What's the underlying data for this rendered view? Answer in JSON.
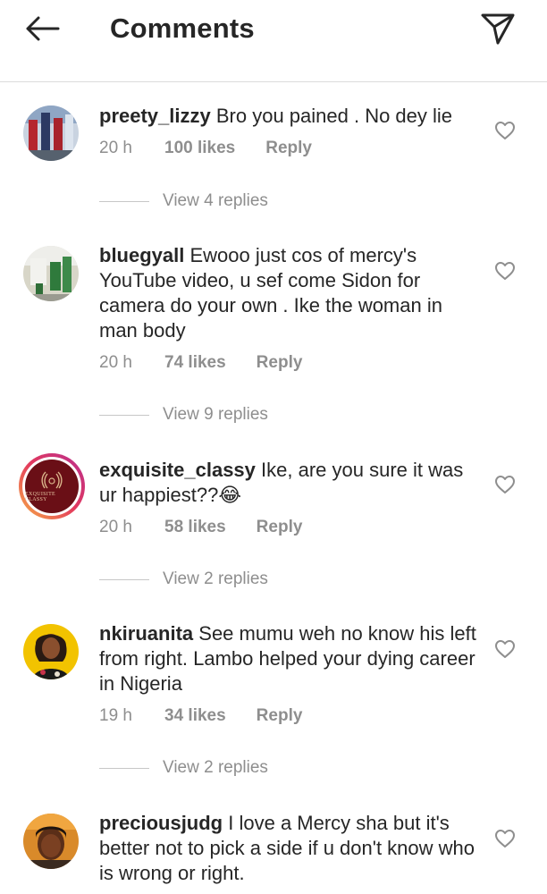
{
  "header": {
    "title": "Comments",
    "back_icon": "arrow-left-icon",
    "share_icon": "send-icon"
  },
  "comments": [
    {
      "username": "preety_lizzy",
      "text": "Bro you pained . No dey lie",
      "time": "20 h",
      "likes": "100 likes",
      "reply": "Reply",
      "view_replies": "View 4 replies"
    },
    {
      "username": "bluegyall",
      "text": "Ewooo just cos of mercy's YouTube video, u sef come Sidon for camera do your own . Ike the woman in man body",
      "time": "20 h",
      "likes": "74 likes",
      "reply": "Reply",
      "view_replies": "View 9 replies"
    },
    {
      "username": "exquisite_classy",
      "text": "Ike, are you sure it was ur happiest??😂",
      "time": "20 h",
      "likes": "58 likes",
      "reply": "Reply",
      "view_replies": "View 2 replies",
      "avatar_logo_text": "EXQUISITE CLASSY"
    },
    {
      "username": "nkiruanita",
      "text": "See mumu weh no know his left from right. Lambo helped your dying career in Nigeria",
      "time": "19 h",
      "likes": "34 likes",
      "reply": "Reply",
      "view_replies": "View 2 replies"
    },
    {
      "username": "preciousjudg",
      "text": "I love a Mercy sha but it's better not to pick a side if u don't know who is wrong or right."
    }
  ],
  "colors": {
    "text": "#262626",
    "muted": "#8e8e8e",
    "divider": "#dbdbdb"
  }
}
